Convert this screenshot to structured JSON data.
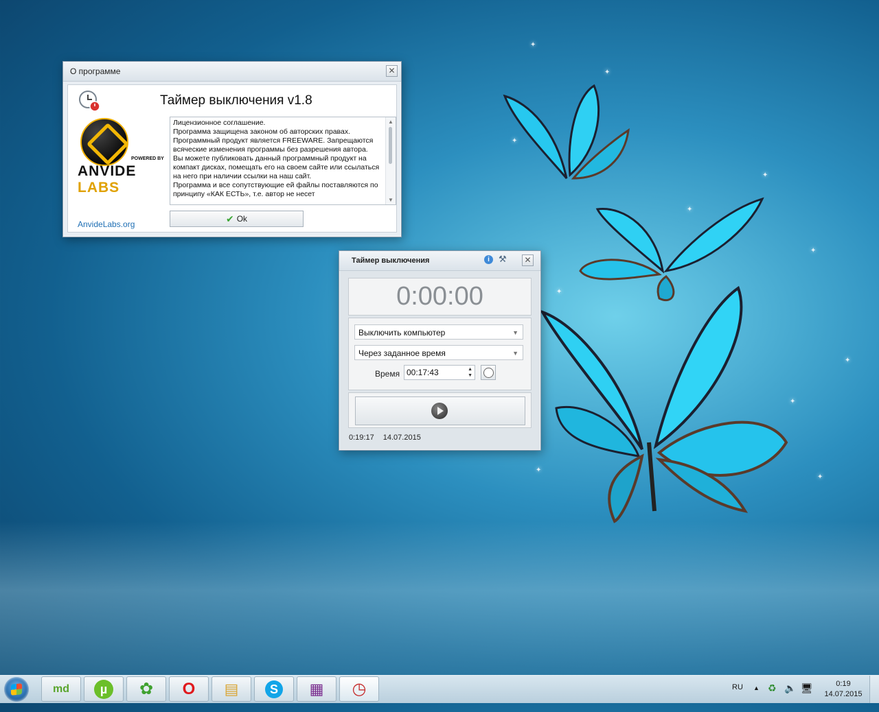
{
  "about_window": {
    "title": "О программе",
    "close": "✕",
    "heading": "Таймер выключения v1.8",
    "logo_main": "ANVIDE",
    "logo_accent": "LABS",
    "logo_powered": "POWERED BY",
    "site": "AnvideLabs.org",
    "license_lines": [
      "Лицензионное соглашение.",
      "Программа защищена законом об авторских правах.",
      "Программный продукт является FREEWARE. Запрещаются всяческие изменения программы без разрешения автора.",
      "Вы можете публиковать данный программный продукт на компакт дисках, помещать его на своем сайте или ссылаться на него при наличии ссылки на наш сайт.",
      "Программа и все сопутствующие ей файлы поставляются по принципу «КАК ЕСТЬ», т.е. автор не несет"
    ],
    "ok_label": "Ok"
  },
  "timer_window": {
    "title": "Таймер выключения",
    "close": "✕",
    "countdown": "0:00:00",
    "action_selected": "Выключить компьютер",
    "mode_selected": "Через заданное время",
    "time_label": "Время",
    "time_value": "00:17:43",
    "status_time": "0:19:17",
    "status_date": "14.07.2015"
  },
  "taskbar": {
    "apps": [
      "start",
      "mediaget",
      "utorrent",
      "icq",
      "opera",
      "explorer",
      "skype",
      "winrar",
      "shutdown-timer"
    ],
    "icons": {
      "mediaget": "md",
      "utorrent": "µ",
      "icq": "✿",
      "opera": "O",
      "explorer": "▤",
      "skype": "S",
      "winrar": "▦",
      "timer": "◷"
    },
    "lang": "RU",
    "clock_time": "0:19",
    "clock_date": "14.07.2015"
  }
}
